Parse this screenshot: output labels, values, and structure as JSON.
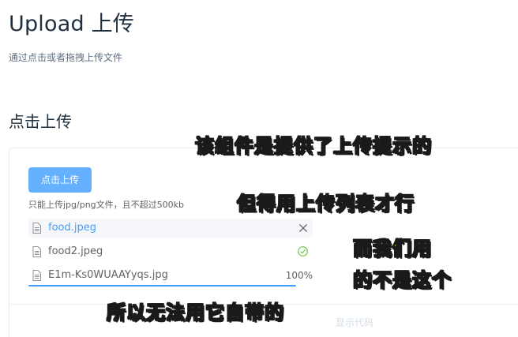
{
  "header": {
    "title": "Upload 上传",
    "subtitle": "通过点击或者拖拽上传文件"
  },
  "section": {
    "title": "点击上传"
  },
  "upload": {
    "button_label": "点击上传",
    "tip": "只能上传jpg/png文件，且不超过500kb",
    "files": [
      {
        "name": "food.jpeg",
        "state": "hovered"
      },
      {
        "name": "food2.jpeg",
        "state": "success"
      },
      {
        "name": "E1m-Ks0WUAAYyqs.jpg",
        "state": "uploading",
        "progress_label": "100%",
        "progress": 1.0
      }
    ]
  },
  "footer": {
    "show_code_label": "显示代码"
  },
  "annotations": {
    "line1": "该组件是提供了上传提示的",
    "line2": "但得用上传列表才行",
    "line3": "而我们用",
    "line4": "的不是这个",
    "line5": "所以无法用它自带的"
  },
  "colors": {
    "primary": "#409eff",
    "button_bg": "#66b1ff",
    "success": "#67c23a",
    "annotation": "#ffe600"
  }
}
